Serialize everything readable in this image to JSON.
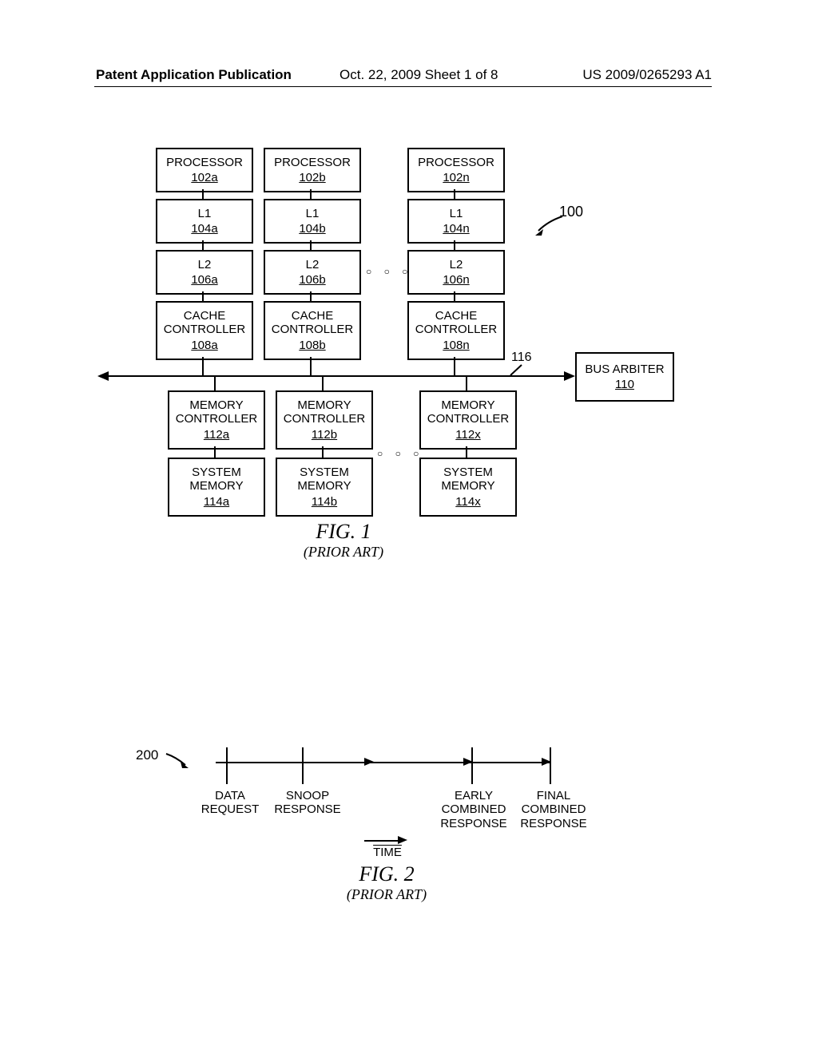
{
  "header": {
    "left": "Patent Application Publication",
    "center": "Oct. 22, 2009  Sheet 1 of 8",
    "right": "US 2009/0265293 A1"
  },
  "fig1": {
    "ref100": "100",
    "ref116": "116",
    "bus_arbiter": {
      "label": "BUS ARBITER",
      "ref": "110"
    },
    "cols": [
      {
        "proc": {
          "label": "PROCESSOR",
          "ref": "102a"
        },
        "l1": {
          "label": "L1",
          "ref": "104a"
        },
        "l2": {
          "label": "L2",
          "ref": "106a"
        },
        "cc": {
          "label": "CACHE\nCONTROLLER",
          "ref": "108a"
        },
        "mc": {
          "label": "MEMORY\nCONTROLLER",
          "ref": "112a"
        },
        "sm": {
          "label": "SYSTEM\nMEMORY",
          "ref": "114a"
        }
      },
      {
        "proc": {
          "label": "PROCESSOR",
          "ref": "102b"
        },
        "l1": {
          "label": "L1",
          "ref": "104b"
        },
        "l2": {
          "label": "L2",
          "ref": "106b"
        },
        "cc": {
          "label": "CACHE\nCONTROLLER",
          "ref": "108b"
        },
        "mc": {
          "label": "MEMORY\nCONTROLLER",
          "ref": "112b"
        },
        "sm": {
          "label": "SYSTEM\nMEMORY",
          "ref": "114b"
        }
      },
      {
        "proc": {
          "label": "PROCESSOR",
          "ref": "102n"
        },
        "l1": {
          "label": "L1",
          "ref": "104n"
        },
        "l2": {
          "label": "L2",
          "ref": "106n"
        },
        "cc": {
          "label": "CACHE\nCONTROLLER",
          "ref": "108n"
        },
        "mc": {
          "label": "MEMORY\nCONTROLLER",
          "ref": "112x"
        },
        "sm": {
          "label": "SYSTEM\nMEMORY",
          "ref": "114x"
        }
      }
    ],
    "dots": "○ ○ ○",
    "caption_num": "FIG. 1",
    "caption_sub": "(PRIOR ART)"
  },
  "fig2": {
    "ref200": "200",
    "events": [
      {
        "label": "DATA\nREQUEST"
      },
      {
        "label": "SNOOP\nRESPONSE"
      },
      {
        "label": "EARLY\nCOMBINED\nRESPONSE"
      },
      {
        "label": "FINAL\nCOMBINED\nRESPONSE"
      }
    ],
    "time_label": "TIME",
    "caption_num": "FIG. 2",
    "caption_sub": "(PRIOR ART)"
  }
}
